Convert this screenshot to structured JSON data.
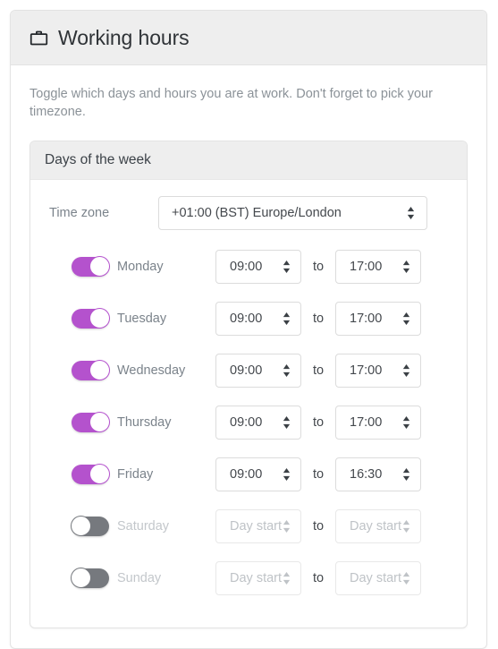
{
  "card": {
    "title": "Working hours",
    "title_icon": "briefcase-icon",
    "description": "Toggle which days and hours you are at work. Don't forget to pick your timezone."
  },
  "panel": {
    "heading": "Days of the week",
    "timezone": {
      "label": "Time zone",
      "value": "+01:00 (BST) Europe/London"
    },
    "separator_label": "to",
    "disabled_placeholder": "Day start",
    "colors": {
      "toggle_on": "#b452cd",
      "toggle_off": "#76797e",
      "header_bg": "#eeeeee",
      "border": "#e3e3e3",
      "muted_text": "#8b9298"
    },
    "days": [
      {
        "name": "Monday",
        "enabled": true,
        "start": "09:00",
        "end": "17:00"
      },
      {
        "name": "Tuesday",
        "enabled": true,
        "start": "09:00",
        "end": "17:00"
      },
      {
        "name": "Wednesday",
        "enabled": true,
        "start": "09:00",
        "end": "17:00"
      },
      {
        "name": "Thursday",
        "enabled": true,
        "start": "09:00",
        "end": "17:00"
      },
      {
        "name": "Friday",
        "enabled": true,
        "start": "09:00",
        "end": "16:30"
      },
      {
        "name": "Saturday",
        "enabled": false,
        "start": "Day start",
        "end": "Day start"
      },
      {
        "name": "Sunday",
        "enabled": false,
        "start": "Day start",
        "end": "Day start"
      }
    ]
  }
}
